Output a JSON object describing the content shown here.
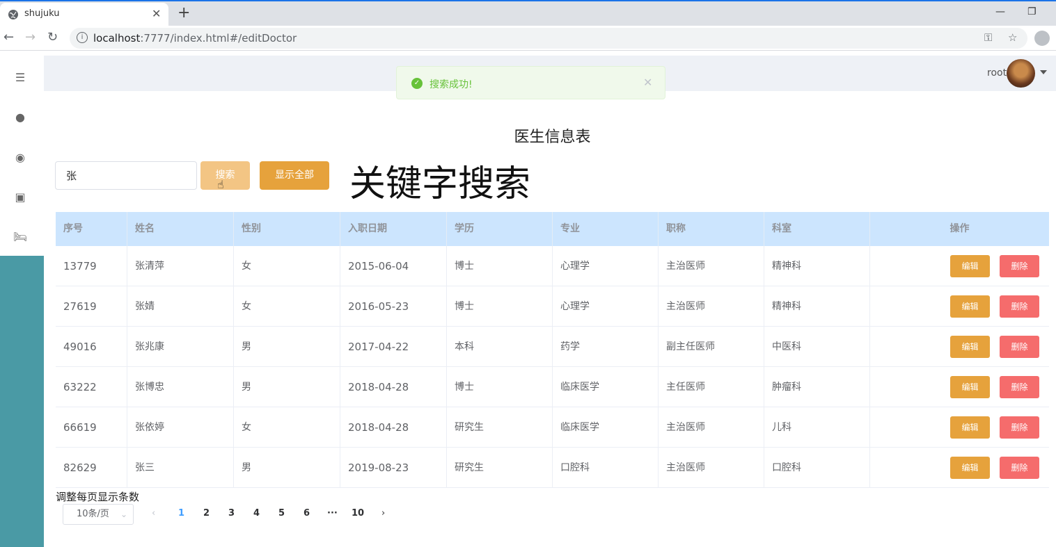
{
  "browser": {
    "tab_title": "shujuku",
    "tab_close": "✕",
    "new_tab": "+",
    "url_host": "localhost",
    "url_path": ":7777/index.html#/editDoctor"
  },
  "header": {
    "user": "root",
    "toast": "搜索成功!"
  },
  "page": {
    "title": "医生信息表",
    "search_value": "张",
    "search_button": "搜索",
    "show_all_button": "显示全部",
    "annotation": "关键字搜索"
  },
  "table": {
    "headers": [
      "序号",
      "姓名",
      "性别",
      "入职日期",
      "学历",
      "专业",
      "职称",
      "科室",
      "操作"
    ],
    "rows": [
      {
        "id": "13779",
        "name": "张清萍",
        "gender": "女",
        "date": "2015-06-04",
        "edu": "博士",
        "major": "心理学",
        "title": "主治医师",
        "dept": "精神科"
      },
      {
        "id": "27619",
        "name": "张婧",
        "gender": "女",
        "date": "2016-05-23",
        "edu": "博士",
        "major": "心理学",
        "title": "主治医师",
        "dept": "精神科"
      },
      {
        "id": "49016",
        "name": "张兆康",
        "gender": "男",
        "date": "2017-04-22",
        "edu": "本科",
        "major": "药学",
        "title": "副主任医师",
        "dept": "中医科"
      },
      {
        "id": "63222",
        "name": "张博忠",
        "gender": "男",
        "date": "2018-04-28",
        "edu": "博士",
        "major": "临床医学",
        "title": "主任医师",
        "dept": "肿瘤科"
      },
      {
        "id": "66619",
        "name": "张依婷",
        "gender": "女",
        "date": "2018-04-28",
        "edu": "研究生",
        "major": "临床医学",
        "title": "主治医师",
        "dept": "儿科"
      },
      {
        "id": "82629",
        "name": "张三",
        "gender": "男",
        "date": "2019-08-23",
        "edu": "研究生",
        "major": "口腔科",
        "title": "主治医师",
        "dept": "口腔科"
      }
    ],
    "edit_label": "编辑",
    "delete_label": "删除"
  },
  "pagination": {
    "size_label": "调整每页显示条数",
    "page_size": "10条/页",
    "pages": [
      "1",
      "2",
      "3",
      "4",
      "5",
      "6",
      "···",
      "10"
    ],
    "current": "1"
  },
  "colors": {
    "header_bg": "#cce5fe",
    "edit": "#e6a23c",
    "delete": "#f56c6c",
    "sidebar": "#4a9aa5"
  }
}
